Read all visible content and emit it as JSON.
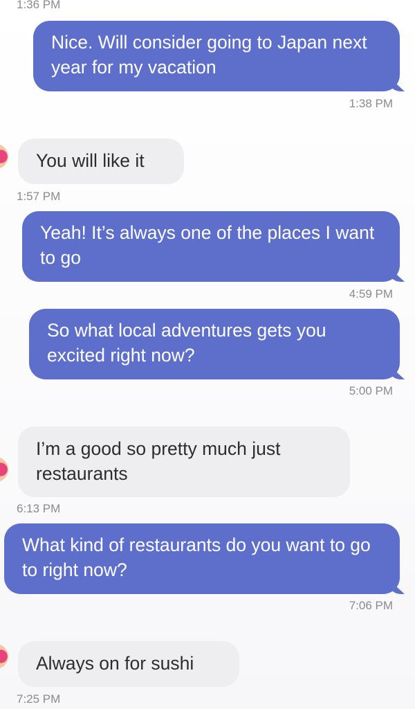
{
  "messages": [
    {
      "dir": "time",
      "text": "1:36 PM"
    },
    {
      "dir": "sent",
      "text": "Nice. Will consider going to Japan next year for my vacation",
      "time": "1:38 PM"
    },
    {
      "dir": "recv",
      "text": "You will like it",
      "time": "1:57 PM"
    },
    {
      "dir": "sent",
      "text": "Yeah! It’s always one of the places I want to go",
      "time": "4:59 PM"
    },
    {
      "dir": "sent",
      "text": "So what local adventures gets you excited right now?",
      "time": "5:00 PM"
    },
    {
      "dir": "recv",
      "text": "I’m a good so pretty much just restaurants",
      "time": "6:13 PM"
    },
    {
      "dir": "sent",
      "text": "What kind of restaurants do you want to go to right now?",
      "time": "7:06 PM"
    },
    {
      "dir": "recv",
      "text": "Always on for sushi",
      "time": "7:25 PM"
    }
  ],
  "colors": {
    "sent_bubble": "#5e6fcb",
    "recv_bubble": "#eeeef1",
    "timestamp": "#8a8a8e"
  }
}
